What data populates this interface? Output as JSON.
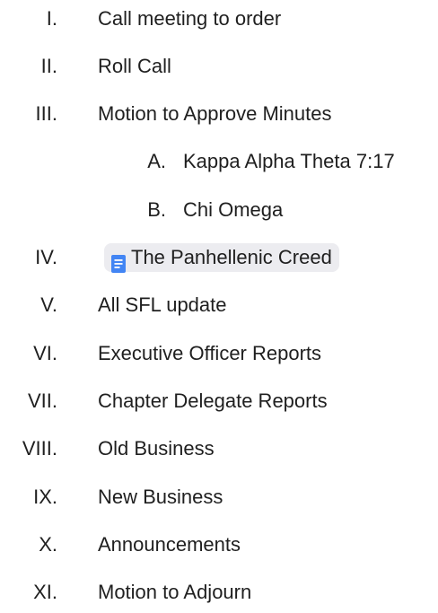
{
  "agenda": {
    "items": [
      {
        "numeral": "I.",
        "text": "Call meeting to order"
      },
      {
        "numeral": "II.",
        "text": "Roll Call"
      },
      {
        "numeral": "III.",
        "text": "Motion to Approve Minutes"
      },
      {
        "numeral": "A.",
        "text": "Kappa Alpha Theta 7:17"
      },
      {
        "numeral": "B.",
        "text": "Chi Omega"
      },
      {
        "numeral": "IV.",
        "text": "The Panhellenic Creed"
      },
      {
        "numeral": "V.",
        "text": "All SFL update"
      },
      {
        "numeral": "VI.",
        "text": "Executive Officer Reports"
      },
      {
        "numeral": "VII.",
        "text": "Chapter Delegate Reports"
      },
      {
        "numeral": "VIII.",
        "text": "Old Business"
      },
      {
        "numeral": "IX.",
        "text": "New Business"
      },
      {
        "numeral": "X.",
        "text": "Announcements"
      },
      {
        "numeral": "XI.",
        "text": "Motion to Adjourn"
      }
    ]
  },
  "colors": {
    "text": "#1f1f1f",
    "chip_background": "#ececf0",
    "doc_icon": "#4285f4"
  },
  "icons": {
    "doc_chip_icon": "google-docs-icon"
  }
}
